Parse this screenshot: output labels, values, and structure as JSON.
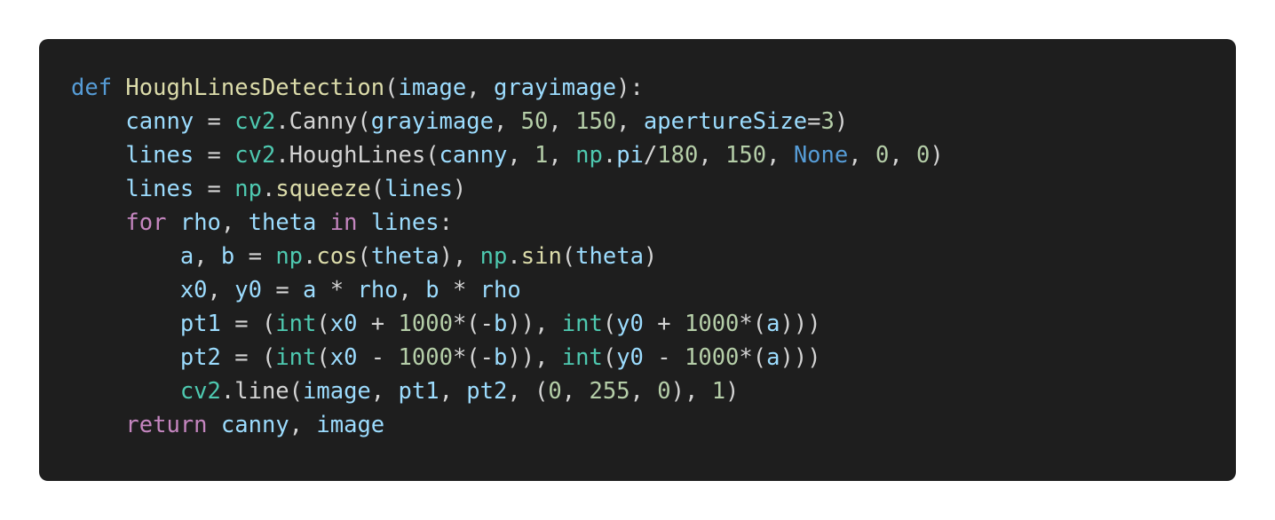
{
  "theme": {
    "background": "#1e1e1e",
    "page_background": "#ffffff",
    "colors": {
      "default": "#d4d4d4",
      "keyword_def": "#569cd6",
      "function": "#dcdcaa",
      "variable": "#9cdcfe",
      "module": "#4ec9b0",
      "number": "#b5cea8",
      "control": "#c586c0",
      "constant": "#569cd6"
    }
  },
  "code": {
    "language": "python",
    "lines": [
      [
        [
          "def",
          "keyword_def"
        ],
        [
          " ",
          "default"
        ],
        [
          "HoughLinesDetection",
          "function"
        ],
        [
          "(",
          "default"
        ],
        [
          "image",
          "variable"
        ],
        [
          ", ",
          "default"
        ],
        [
          "grayimage",
          "variable"
        ],
        [
          "):",
          "default"
        ]
      ],
      [
        [
          "    ",
          "default"
        ],
        [
          "canny",
          "variable"
        ],
        [
          " = ",
          "default"
        ],
        [
          "cv2",
          "module"
        ],
        [
          ".Canny(",
          "default"
        ],
        [
          "grayimage",
          "variable"
        ],
        [
          ", ",
          "default"
        ],
        [
          "50",
          "number"
        ],
        [
          ", ",
          "default"
        ],
        [
          "150",
          "number"
        ],
        [
          ", ",
          "default"
        ],
        [
          "apertureSize",
          "variable"
        ],
        [
          "=",
          "default"
        ],
        [
          "3",
          "number"
        ],
        [
          ")",
          "default"
        ]
      ],
      [
        [
          "    ",
          "default"
        ],
        [
          "lines",
          "variable"
        ],
        [
          " = ",
          "default"
        ],
        [
          "cv2",
          "module"
        ],
        [
          ".HoughLines(",
          "default"
        ],
        [
          "canny",
          "variable"
        ],
        [
          ", ",
          "default"
        ],
        [
          "1",
          "number"
        ],
        [
          ", ",
          "default"
        ],
        [
          "np",
          "module"
        ],
        [
          ".",
          "default"
        ],
        [
          "pi",
          "variable"
        ],
        [
          "/",
          "default"
        ],
        [
          "180",
          "number"
        ],
        [
          ", ",
          "default"
        ],
        [
          "150",
          "number"
        ],
        [
          ", ",
          "default"
        ],
        [
          "None",
          "constant"
        ],
        [
          ", ",
          "default"
        ],
        [
          "0",
          "number"
        ],
        [
          ", ",
          "default"
        ],
        [
          "0",
          "number"
        ],
        [
          ")",
          "default"
        ]
      ],
      [
        [
          "    ",
          "default"
        ],
        [
          "lines",
          "variable"
        ],
        [
          " = ",
          "default"
        ],
        [
          "np",
          "module"
        ],
        [
          ".",
          "default"
        ],
        [
          "squeeze",
          "function"
        ],
        [
          "(",
          "default"
        ],
        [
          "lines",
          "variable"
        ],
        [
          ")",
          "default"
        ]
      ],
      [
        [
          "    ",
          "default"
        ],
        [
          "for",
          "control"
        ],
        [
          " ",
          "default"
        ],
        [
          "rho",
          "variable"
        ],
        [
          ", ",
          "default"
        ],
        [
          "theta",
          "variable"
        ],
        [
          " ",
          "default"
        ],
        [
          "in",
          "control"
        ],
        [
          " ",
          "default"
        ],
        [
          "lines",
          "variable"
        ],
        [
          ":",
          "default"
        ]
      ],
      [
        [
          "        ",
          "default"
        ],
        [
          "a",
          "variable"
        ],
        [
          ", ",
          "default"
        ],
        [
          "b",
          "variable"
        ],
        [
          " = ",
          "default"
        ],
        [
          "np",
          "module"
        ],
        [
          ".",
          "default"
        ],
        [
          "cos",
          "function"
        ],
        [
          "(",
          "default"
        ],
        [
          "theta",
          "variable"
        ],
        [
          "), ",
          "default"
        ],
        [
          "np",
          "module"
        ],
        [
          ".",
          "default"
        ],
        [
          "sin",
          "function"
        ],
        [
          "(",
          "default"
        ],
        [
          "theta",
          "variable"
        ],
        [
          ")",
          "default"
        ]
      ],
      [
        [
          "        ",
          "default"
        ],
        [
          "x0",
          "variable"
        ],
        [
          ", ",
          "default"
        ],
        [
          "y0",
          "variable"
        ],
        [
          " = ",
          "default"
        ],
        [
          "a",
          "variable"
        ],
        [
          " * ",
          "default"
        ],
        [
          "rho",
          "variable"
        ],
        [
          ", ",
          "default"
        ],
        [
          "b",
          "variable"
        ],
        [
          " * ",
          "default"
        ],
        [
          "rho",
          "variable"
        ]
      ],
      [
        [
          "        ",
          "default"
        ],
        [
          "pt1",
          "variable"
        ],
        [
          " = (",
          "default"
        ],
        [
          "int",
          "module"
        ],
        [
          "(",
          "default"
        ],
        [
          "x0",
          "variable"
        ],
        [
          " + ",
          "default"
        ],
        [
          "1000",
          "number"
        ],
        [
          "*(-",
          "default"
        ],
        [
          "b",
          "variable"
        ],
        [
          ")), ",
          "default"
        ],
        [
          "int",
          "module"
        ],
        [
          "(",
          "default"
        ],
        [
          "y0",
          "variable"
        ],
        [
          " + ",
          "default"
        ],
        [
          "1000",
          "number"
        ],
        [
          "*(",
          "default"
        ],
        [
          "a",
          "variable"
        ],
        [
          ")))",
          "default"
        ]
      ],
      [
        [
          "        ",
          "default"
        ],
        [
          "pt2",
          "variable"
        ],
        [
          " = (",
          "default"
        ],
        [
          "int",
          "module"
        ],
        [
          "(",
          "default"
        ],
        [
          "x0",
          "variable"
        ],
        [
          " - ",
          "default"
        ],
        [
          "1000",
          "number"
        ],
        [
          "*(-",
          "default"
        ],
        [
          "b",
          "variable"
        ],
        [
          ")), ",
          "default"
        ],
        [
          "int",
          "module"
        ],
        [
          "(",
          "default"
        ],
        [
          "y0",
          "variable"
        ],
        [
          " - ",
          "default"
        ],
        [
          "1000",
          "number"
        ],
        [
          "*(",
          "default"
        ],
        [
          "a",
          "variable"
        ],
        [
          ")))",
          "default"
        ]
      ],
      [
        [
          "        ",
          "default"
        ],
        [
          "cv2",
          "module"
        ],
        [
          ".line(",
          "default"
        ],
        [
          "image",
          "variable"
        ],
        [
          ", ",
          "default"
        ],
        [
          "pt1",
          "variable"
        ],
        [
          ", ",
          "default"
        ],
        [
          "pt2",
          "variable"
        ],
        [
          ", (",
          "default"
        ],
        [
          "0",
          "number"
        ],
        [
          ", ",
          "default"
        ],
        [
          "255",
          "number"
        ],
        [
          ", ",
          "default"
        ],
        [
          "0",
          "number"
        ],
        [
          "), ",
          "default"
        ],
        [
          "1",
          "number"
        ],
        [
          ")",
          "default"
        ]
      ],
      [
        [
          "    ",
          "default"
        ],
        [
          "return",
          "control"
        ],
        [
          " ",
          "default"
        ],
        [
          "canny",
          "variable"
        ],
        [
          ", ",
          "default"
        ],
        [
          "image",
          "variable"
        ]
      ]
    ]
  }
}
